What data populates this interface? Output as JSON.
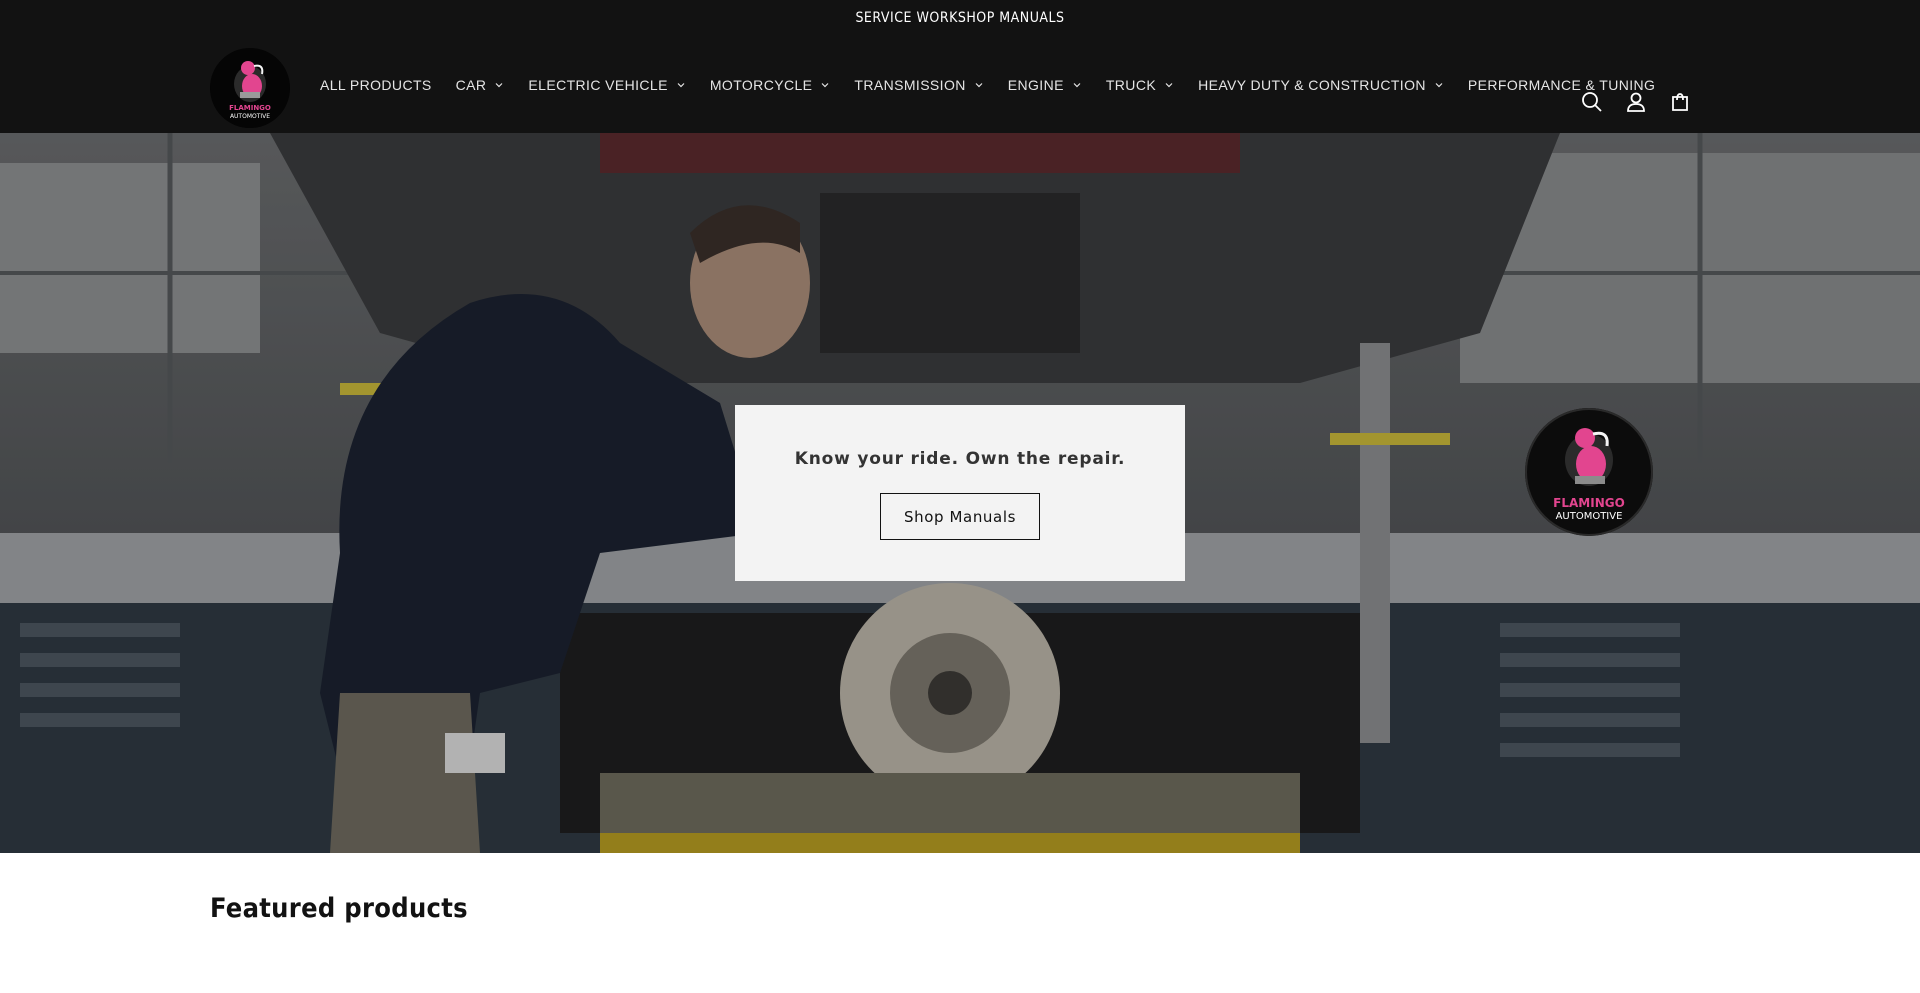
{
  "announcement": {
    "text": "SERVICE WORKSHOP MANUALS"
  },
  "header": {
    "logo_alt": "FLAMINGO AUTOMOTIVE",
    "nav": [
      {
        "label": "ALL PRODUCTS",
        "has_dropdown": false
      },
      {
        "label": "CAR",
        "has_dropdown": true
      },
      {
        "label": "ELECTRIC VEHICLE",
        "has_dropdown": true
      },
      {
        "label": "MOTORCYCLE",
        "has_dropdown": true
      },
      {
        "label": "TRANSMISSION",
        "has_dropdown": true
      },
      {
        "label": "ENGINE",
        "has_dropdown": true
      },
      {
        "label": "TRUCK",
        "has_dropdown": true
      },
      {
        "label": "HEAVY DUTY & CONSTRUCTION",
        "has_dropdown": true
      },
      {
        "label": "PERFORMANCE & TUNING",
        "has_dropdown": false
      }
    ],
    "icons": [
      "search-icon",
      "account-icon",
      "cart-icon"
    ]
  },
  "hero": {
    "heading": "Know your ride. Own the repair.",
    "button_label": "Shop Manuals",
    "badge_line1": "FLAMINGO",
    "badge_line2": "AUTOMOTIVE"
  },
  "featured": {
    "title": "Featured products"
  },
  "colors": {
    "header_bg": "#121212",
    "brand_pink": "#e2458f",
    "hero_box_bg": "#f3f3f3"
  }
}
